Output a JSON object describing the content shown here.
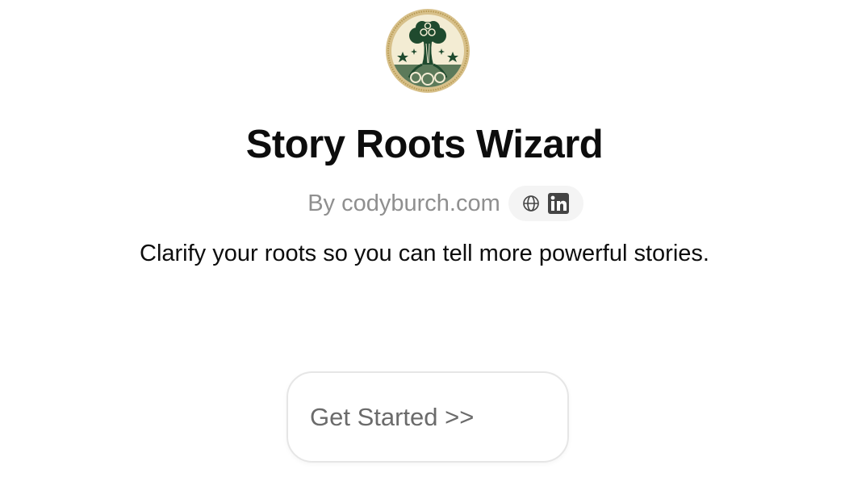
{
  "gpt": {
    "logo_icon": "tree-roots-emblem-icon",
    "title": "Story Roots Wizard",
    "author": "By codyburch.com",
    "social_icons": [
      "globe-icon",
      "linkedin-icon"
    ],
    "description": "Clarify your roots so you can tell more powerful stories."
  },
  "conversation_starters": [
    {
      "label": "Get Started >>"
    }
  ],
  "colors": {
    "logo_green": "#1f4a2e",
    "logo_cream": "#f3ecd3",
    "logo_gold": "#c9a95a",
    "title": "#0d0d0d",
    "muted": "#8f8f8f",
    "pill_bg": "#f4f4f4",
    "card_border": "#e6e6e6"
  }
}
